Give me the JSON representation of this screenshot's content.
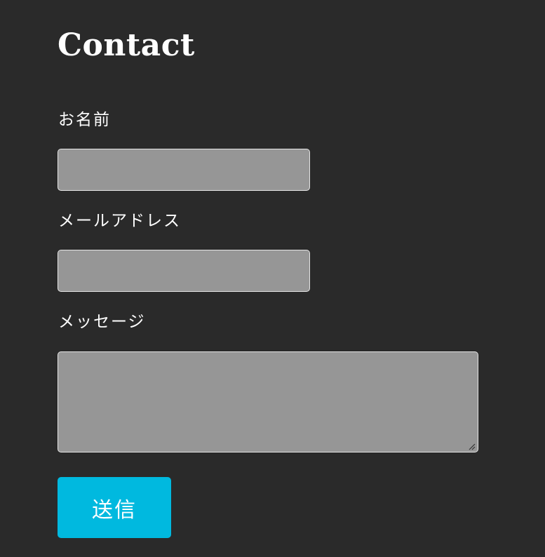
{
  "page": {
    "title": "Contact"
  },
  "form": {
    "name_label": "お名前",
    "name_value": "",
    "email_label": "メールアドレス",
    "email_value": "",
    "message_label": "メッセージ",
    "message_value": "",
    "submit_label": "送信"
  },
  "colors": {
    "background": "#2a2a2a",
    "field_background": "#969696",
    "field_border": "#e6e6e6",
    "accent": "#00b9df",
    "text": "#ffffff"
  },
  "icons": {
    "textarea_resize": "resize-grip-icon"
  }
}
